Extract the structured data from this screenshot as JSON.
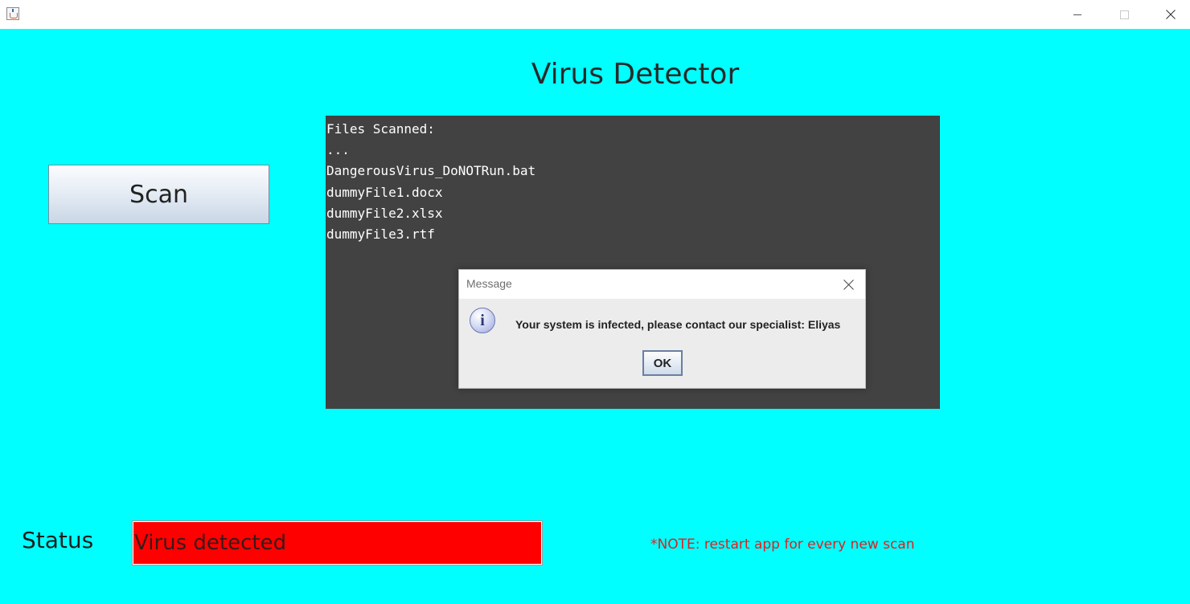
{
  "window": {
    "icon": "java-coffee-cup-icon",
    "controls": {
      "minimize": "minimize-icon",
      "maximize": "maximize-icon",
      "close": "close-icon"
    }
  },
  "main": {
    "title": "Virus Detector",
    "scan_button_label": "Scan",
    "output_lines": [
      "Files Scanned:",
      "...",
      "DangerousVirus_DoNOTRun.bat",
      "dummyFile1.docx",
      "dummyFile2.xlsx",
      "dummyFile3.rtf"
    ]
  },
  "dialog": {
    "title": "Message",
    "icon": "info-icon",
    "icon_glyph": "i",
    "message": "Your system is infected, please contact our specialist: Eliyas",
    "ok_label": "OK"
  },
  "status": {
    "label": "Status",
    "value": "Virus detected",
    "color": "#ff0000"
  },
  "note": "*NOTE: restart app for every new scan",
  "colors": {
    "background": "#00ffff",
    "output_background": "#424242",
    "note_text": "#e02020"
  }
}
